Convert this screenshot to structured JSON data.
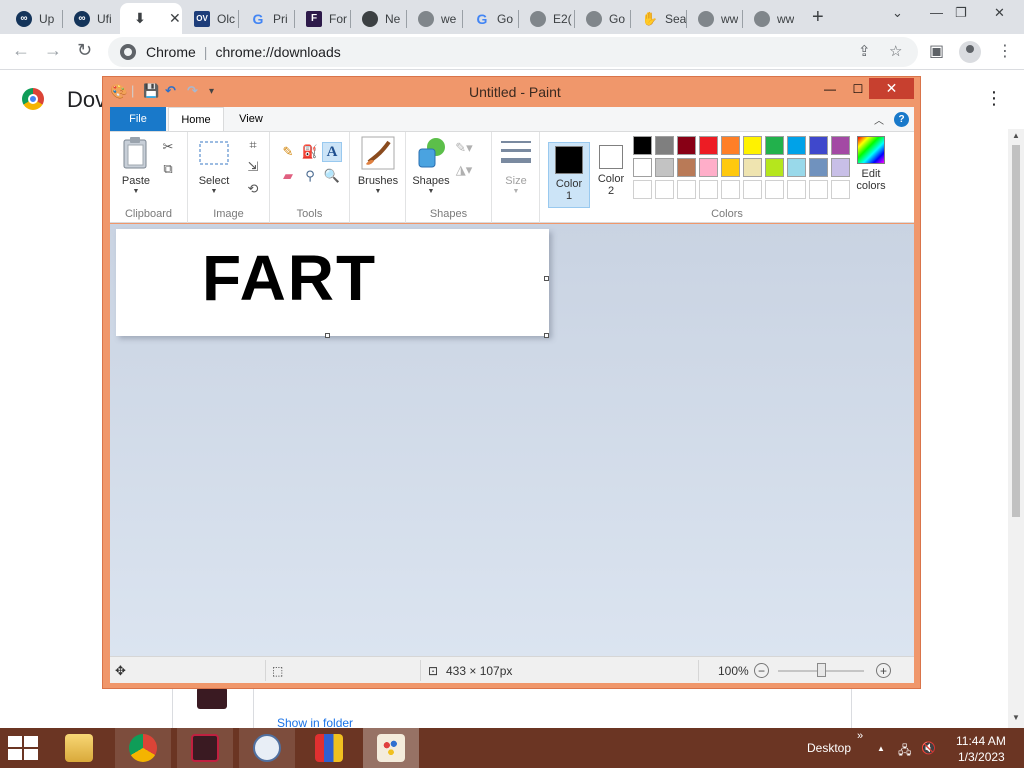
{
  "browser": {
    "tabs": [
      {
        "label": "Up",
        "icon": "upwork-icon"
      },
      {
        "label": "Ufi",
        "icon": "upwork-icon"
      },
      {
        "label": "",
        "icon": "download-icon",
        "active": true
      },
      {
        "label": "Olc",
        "icon": "ov-icon"
      },
      {
        "label": "Pri",
        "icon": "google-icon"
      },
      {
        "label": "For",
        "icon": "f-icon"
      },
      {
        "label": "Ne",
        "icon": "chrome-icon"
      },
      {
        "label": "we",
        "icon": "globe-icon"
      },
      {
        "label": "Go",
        "icon": "google-icon"
      },
      {
        "label": "E2(",
        "icon": "globe-icon"
      },
      {
        "label": "Go",
        "icon": "globe-icon"
      },
      {
        "label": "Sea",
        "icon": "hand-icon"
      },
      {
        "label": "ww",
        "icon": "globe-icon"
      },
      {
        "label": "ww",
        "icon": "globe-icon"
      }
    ],
    "active_tab_close": "✕",
    "new_tab": "+",
    "omnibox": {
      "site": "Chrome",
      "divider": "|",
      "url": "chrome://downloads"
    }
  },
  "downloads_page": {
    "title": "Dov",
    "show_in_folder": "Show in folder"
  },
  "paint": {
    "title": "Untitled - Paint",
    "ribbon_tabs": {
      "file": "File",
      "home": "Home",
      "view": "View"
    },
    "help": "?",
    "groups": {
      "clipboard": {
        "label": "Clipboard",
        "paste": "Paste"
      },
      "image": {
        "label": "Image",
        "select": "Select"
      },
      "tools": {
        "label": "Tools",
        "text_tool": "A"
      },
      "brushes": {
        "label": "Brushes"
      },
      "shapes": {
        "label": "Shapes",
        "shapes_btn": "Shapes"
      },
      "size": {
        "label": "Size"
      },
      "colors": {
        "label": "Colors",
        "color1": "Color",
        "color1_num": "1",
        "color2": "Color",
        "color2_num": "2",
        "edit": "Edit",
        "edit2": "colors"
      }
    },
    "color1_value": "#000000",
    "color2_value": "#ffffff",
    "palette_row1": [
      "#000000",
      "#7f7f7f",
      "#880015",
      "#ed1c24",
      "#ff7f27",
      "#fff200",
      "#22b14c",
      "#00a2e8",
      "#3f48cc",
      "#a349a4"
    ],
    "palette_row2": [
      "#ffffff",
      "#c3c3c3",
      "#b97a57",
      "#ffaec9",
      "#ffc90e",
      "#efe4b0",
      "#b5e61d",
      "#99d9ea",
      "#7092be",
      "#c8bfe7"
    ],
    "canvas_text": "FART",
    "status": {
      "size": "433 × 107px",
      "zoom": "100%"
    }
  },
  "taskbar": {
    "desktop": "Desktop",
    "chevrons": "»",
    "time": "11:44 AM",
    "date": "1/3/2023"
  }
}
